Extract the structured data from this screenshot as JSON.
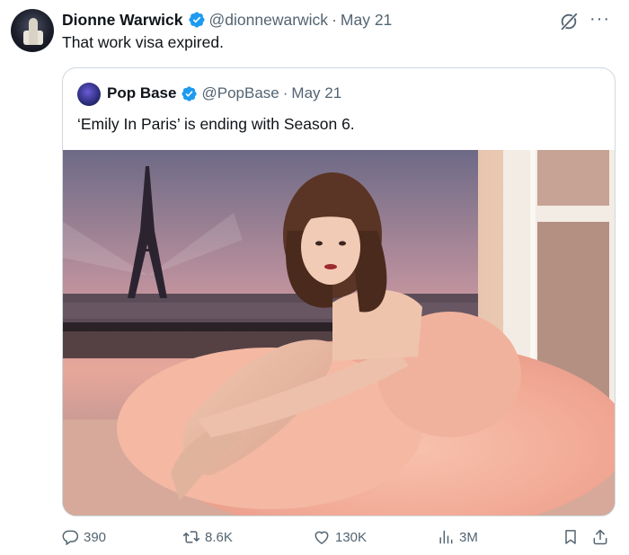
{
  "tweet": {
    "author_name": "Dionne Warwick",
    "handle": "@dionnewarwick",
    "separator": "·",
    "date": "May 21",
    "text": "That work visa expired.",
    "more_label": "···"
  },
  "quote": {
    "author_name": "Pop Base",
    "handle": "@PopBase",
    "separator": "·",
    "date": "May 21",
    "text": "‘Emily In Paris’ is ending with Season 6."
  },
  "actions": {
    "replies": "390",
    "reposts": "8.6K",
    "likes": "130K",
    "views": "3M"
  },
  "colors": {
    "verified": "#1d9bf0",
    "muted": "#536471",
    "border": "#cfd9de"
  },
  "icons": [
    "verified-icon",
    "grok-icon",
    "more-icon",
    "reply-icon",
    "repost-icon",
    "like-icon",
    "views-icon",
    "bookmark-icon",
    "share-icon"
  ]
}
